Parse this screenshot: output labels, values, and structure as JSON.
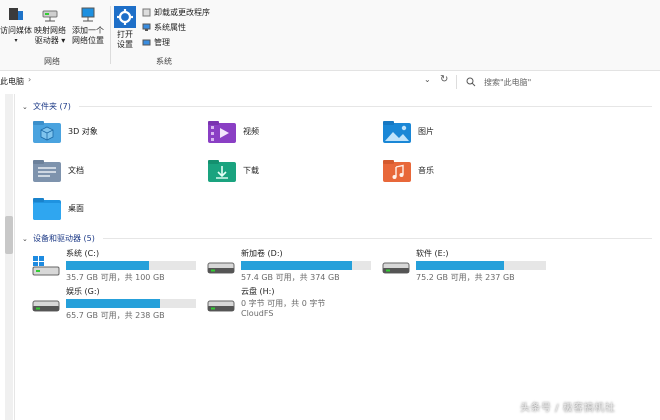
{
  "ribbon": {
    "access_media": "访问媒体",
    "map_drive": [
      "映射网络",
      "驱动器"
    ],
    "add_location": [
      "添加一个",
      "网络位置"
    ],
    "network_group": "网络",
    "open_settings": [
      "打开",
      "设置"
    ],
    "uninstall": "卸载或更改程序",
    "system_props": "系统属性",
    "manage": "管理",
    "system_group": "系统"
  },
  "address": {
    "path": "此电脑",
    "search_placeholder": "搜索\"此电脑\""
  },
  "folders": {
    "header": "文件夹 (7)",
    "items": [
      {
        "label": "3D 对象",
        "icon": "3d-objects-icon"
      },
      {
        "label": "视频",
        "icon": "videos-icon"
      },
      {
        "label": "图片",
        "icon": "pictures-icon"
      },
      {
        "label": "文档",
        "icon": "documents-icon"
      },
      {
        "label": "下载",
        "icon": "downloads-icon"
      },
      {
        "label": "音乐",
        "icon": "music-icon"
      },
      {
        "label": "桌面",
        "icon": "desktop-icon"
      }
    ]
  },
  "drives": {
    "header": "设备和驱动器 (5)",
    "items": [
      {
        "name": "系统 (C:)",
        "free": "35.7 GB 可用，共 100 GB",
        "used_fraction": 0.64,
        "icon": "windows-drive-icon"
      },
      {
        "name": "新加卷 (D:)",
        "free": "57.4 GB 可用，共 374 GB",
        "used_fraction": 0.85,
        "icon": "drive-icon"
      },
      {
        "name": "软件 (E:)",
        "free": "75.2 GB 可用，共 237 GB",
        "used_fraction": 0.68,
        "icon": "drive-icon"
      },
      {
        "name": "娱乐 (G:)",
        "free": "65.7 GB 可用，共 238 GB",
        "used_fraction": 0.72,
        "icon": "drive-icon"
      },
      {
        "name": "云盘 (H:)",
        "free": "0 字节 可用，共 0 字节",
        "extra": "CloudFS",
        "icon": "drive-icon"
      }
    ]
  },
  "watermark": "头条号 / 极客搞机社",
  "colors": {
    "accent": "#26a0da",
    "header": "#1f3c88"
  }
}
